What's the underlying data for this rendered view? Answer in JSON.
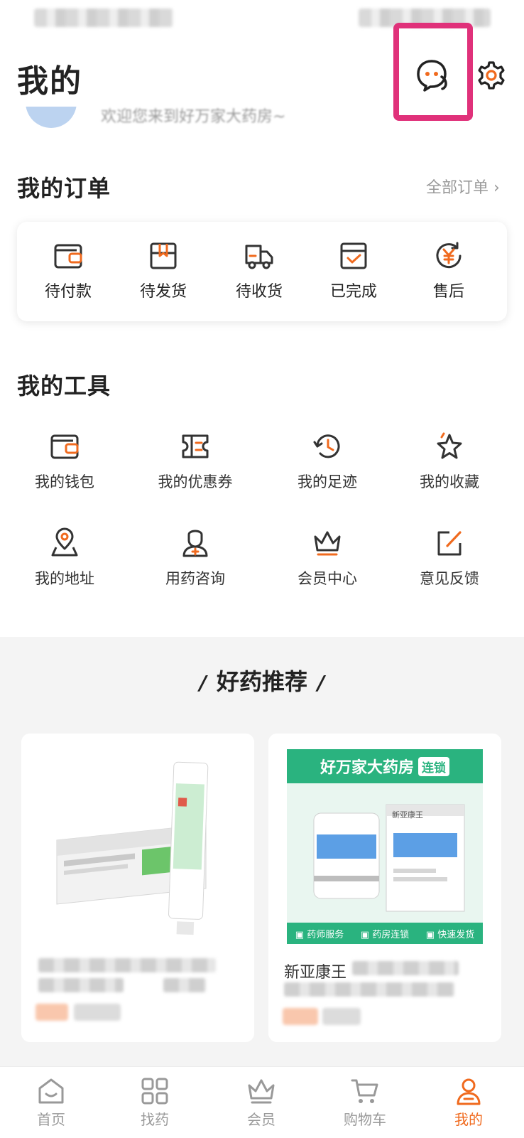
{
  "header": {
    "title": "我的",
    "welcome": "欢迎您来到好万家大药房~"
  },
  "orders": {
    "title": "我的订单",
    "all_label": "全部订单",
    "items": [
      {
        "label": "待付款",
        "icon": "wallet-icon"
      },
      {
        "label": "待发货",
        "icon": "package-icon"
      },
      {
        "label": "待收货",
        "icon": "truck-icon"
      },
      {
        "label": "已完成",
        "icon": "completed-icon"
      },
      {
        "label": "售后",
        "icon": "after-sales-icon"
      }
    ]
  },
  "tools": {
    "title": "我的工具",
    "items": [
      {
        "label": "我的钱包",
        "icon": "wallet-icon"
      },
      {
        "label": "我的优惠券",
        "icon": "coupon-icon"
      },
      {
        "label": "我的足迹",
        "icon": "history-icon"
      },
      {
        "label": "我的收藏",
        "icon": "star-icon"
      },
      {
        "label": "我的地址",
        "icon": "location-icon"
      },
      {
        "label": "用药咨询",
        "icon": "pharmacist-icon"
      },
      {
        "label": "会员中心",
        "icon": "crown-icon"
      },
      {
        "label": "意见反馈",
        "icon": "feedback-icon"
      }
    ]
  },
  "recommend": {
    "title": "好药推荐",
    "banner": {
      "brand": "好万家大药房",
      "tag": "连锁",
      "box_label": "新亚康王",
      "features": [
        "药师服务",
        "药房连锁",
        "快速发货"
      ]
    },
    "product2_name": "新亚康王"
  },
  "tabbar": [
    {
      "label": "首页",
      "icon": "home-icon"
    },
    {
      "label": "找药",
      "icon": "grid-icon"
    },
    {
      "label": "会员",
      "icon": "crown-icon"
    },
    {
      "label": "购物车",
      "icon": "cart-icon"
    },
    {
      "label": "我的",
      "icon": "profile-icon"
    }
  ],
  "colors": {
    "accent": "#f06a1e",
    "highlight": "#e0317a",
    "banner_green": "#2ab37f",
    "icon_dark": "#333333"
  }
}
